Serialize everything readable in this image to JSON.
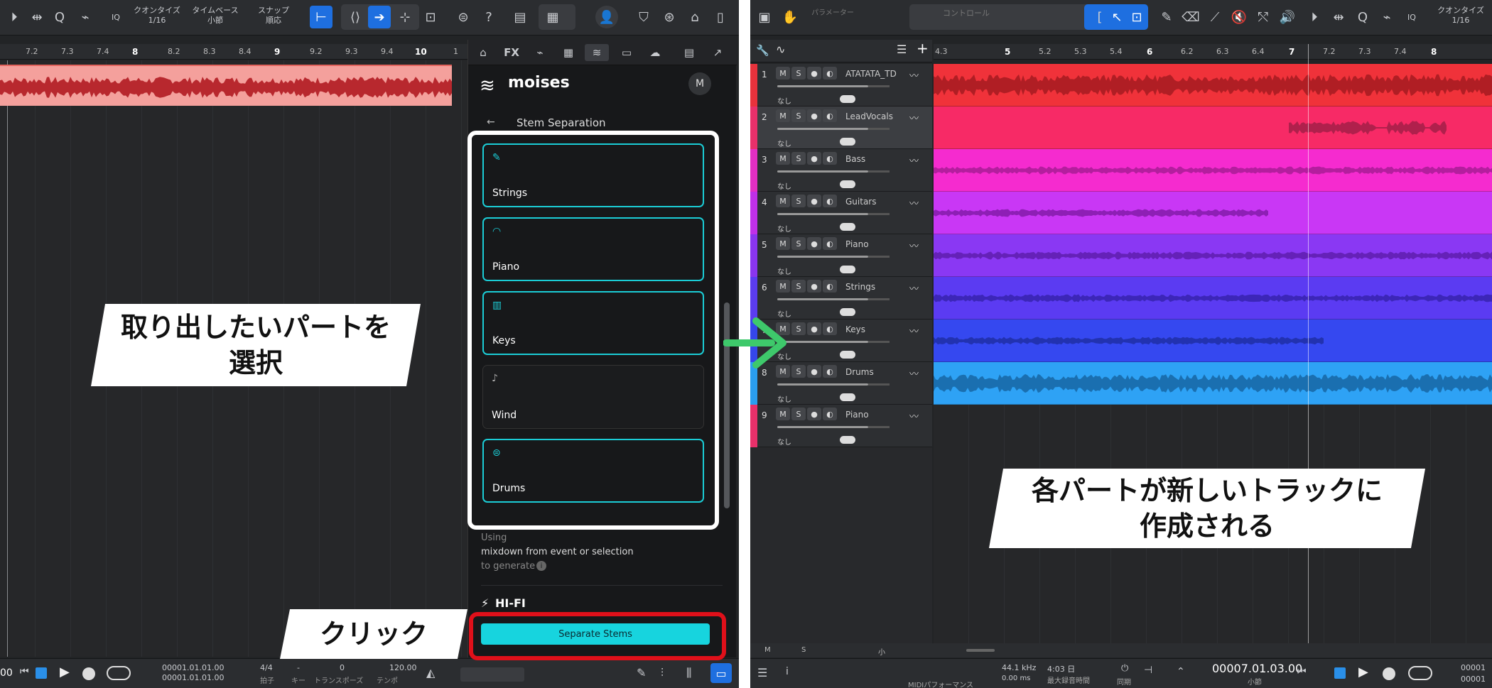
{
  "left_window": {
    "toolbar": {
      "quantize_label": "クオンタイズ",
      "quantize_value": "1/16",
      "timebase_label": "タイムベース",
      "timebase_value": "小節",
      "snap_label": "スナップ",
      "snap_value": "順応",
      "iq_label": "IQ",
      "help_label": "?"
    },
    "ruler_ticks": [
      "7.2",
      "7.3",
      "7.4",
      "8",
      "8.2",
      "8.3",
      "8.4",
      "9",
      "9.2",
      "9.3",
      "9.4",
      "10",
      "1"
    ],
    "moises": {
      "tabs": [
        "⌂",
        "FX",
        "⌁",
        "▦",
        "≋",
        "▭",
        "☁",
        "▤",
        "↗"
      ],
      "brand": "moises",
      "avatar": "M",
      "back_label": "Stem Separation",
      "stems": [
        {
          "name": "Strings",
          "selected": true,
          "icon": "strings-icon"
        },
        {
          "name": "Piano",
          "selected": true,
          "icon": "piano-icon"
        },
        {
          "name": "Keys",
          "selected": true,
          "icon": "keys-icon"
        },
        {
          "name": "Wind",
          "selected": false,
          "icon": "wind-icon"
        },
        {
          "name": "Drums",
          "selected": true,
          "icon": "drums-icon"
        }
      ],
      "using_label": "Using",
      "using_source": "mixdown from event or selection",
      "using_suffix": "to generate",
      "hifi_label": "HI-FI",
      "separate_button": "Separate Stems"
    },
    "bottombar": {
      "pos_start": "00001.01.01.00",
      "pos_end": "00001.01.01.00",
      "time_sig": "4/4",
      "time_sig_label": "拍子",
      "key": "-",
      "key_label": "キー",
      "transpose": "0",
      "transpose_label": "トランスポーズ",
      "tempo": "120.00",
      "tempo_label": "テンポ",
      "left_cut": "00"
    }
  },
  "right_window": {
    "toolbar": {
      "param_label": "パラメーター",
      "control_label": "コントロール",
      "quantize_label": "クオンタイズ",
      "quantize_value": "1/16",
      "iq_label": "IQ"
    },
    "ruler_ticks": [
      "4.3",
      "5",
      "5.2",
      "5.3",
      "5.4",
      "6",
      "6.2",
      "6.3",
      "6.4",
      "7",
      "7.2",
      "7.3",
      "7.4",
      "8"
    ],
    "tracks": [
      {
        "num": "1",
        "name": "ATATATA_TD",
        "color": "#e8323c",
        "lane": "#f0323a",
        "wave": "#b01e24",
        "wave_end": 1.0
      },
      {
        "num": "2",
        "name": "LeadVocals",
        "color": "#e8306a",
        "lane": "#f72a66",
        "wave": "#b0204c",
        "wave_end": 0.92
      },
      {
        "num": "3",
        "name": "Bass",
        "color": "#e32fc4",
        "lane": "#f52bcf",
        "wave": "#b41e9e",
        "wave_end": 1.0
      },
      {
        "num": "4",
        "name": "Guitars",
        "color": "#c030e8",
        "lane": "#c937f5",
        "wave": "#8e1fb5",
        "wave_end": 0.6
      },
      {
        "num": "5",
        "name": "Piano",
        "color": "#8a35ee",
        "lane": "#8a38f3",
        "wave": "#6521b8",
        "wave_end": 1.0
      },
      {
        "num": "6",
        "name": "Strings",
        "color": "#5b3cf0",
        "lane": "#5b3bf2",
        "wave": "#3c26b8",
        "wave_end": 1.0
      },
      {
        "num": "7",
        "name": "Keys",
        "color": "#3546ea",
        "lane": "#3548f0",
        "wave": "#2232b0",
        "wave_end": 0.7
      },
      {
        "num": "8",
        "name": "Drums",
        "color": "#2a9ef0",
        "lane": "#2ea2f5",
        "wave": "#1a6fb0",
        "wave_end": 1.0
      },
      {
        "num": "9",
        "name": "Piano",
        "color": "#e8306a",
        "lane": "",
        "wave": "",
        "wave_end": 0
      }
    ],
    "track_none": "なし",
    "mute": "M",
    "solo": "S",
    "footer_m": "M",
    "footer_s": "S",
    "footer_small": "小",
    "bottombar": {
      "perf_label": "MIDIパフォーマンス",
      "sample_rate": "44.1 kHz",
      "latency": "0.00 ms",
      "record_time": "4:03 日",
      "record_label": "最大録音時間",
      "sync_label": "同期",
      "position": "00007.01.03.00",
      "position_label": "小節",
      "right_pos": "00001",
      "right_pos2": "00001"
    }
  },
  "annotations": {
    "select_parts_line1": "取り出したいパートを",
    "select_parts_line2": "選択",
    "click_label": "クリック",
    "result_line1": "各パートが新しいトラックに",
    "result_line2": "作成される"
  },
  "colors": {
    "accent_cyan": "#1bcdd6",
    "highlight_red": "#e0101a",
    "arrow_green": "#3ec96b",
    "clip_salmon": "#f4a09c",
    "clip_wave": "#b8282e"
  }
}
